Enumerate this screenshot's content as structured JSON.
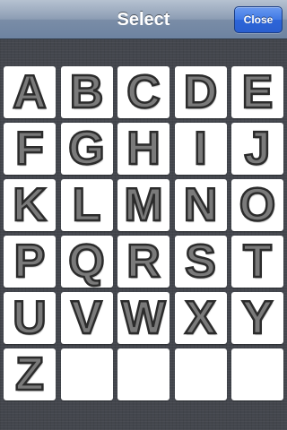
{
  "navbar": {
    "title": "Select",
    "close_label": "Close"
  },
  "letters": [
    "A",
    "B",
    "C",
    "D",
    "E",
    "F",
    "G",
    "H",
    "I",
    "J",
    "K",
    "L",
    "M",
    "N",
    "O",
    "P",
    "Q",
    "R",
    "S",
    "T",
    "U",
    "V",
    "W",
    "X",
    "Y",
    "Z"
  ],
  "empty_tile_count": 4,
  "colors": {
    "background": "#43464d",
    "tile": "#ffffff",
    "letter_fill": "#7a7a7a",
    "letter_outline": "#2b2b2b",
    "close_button": "#3f78e4"
  }
}
